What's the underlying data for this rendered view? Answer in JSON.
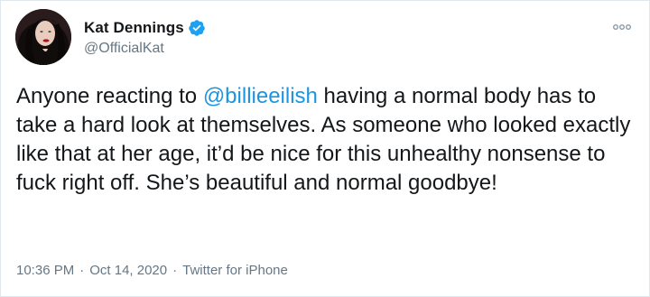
{
  "author": {
    "name": "Kat Dennings",
    "handle": "@OfficialKat",
    "verified": true
  },
  "tweet": {
    "text_before": "Anyone reacting to ",
    "mention": "@billieeilish",
    "text_after": " having a normal body has to take a hard look at themselves. As someone who looked exactly like that at her age, it’d be nice for this unhealthy nonsense to fuck right off. She’s beautiful and normal goodbye!"
  },
  "meta": {
    "time": "10:36 PM",
    "separator": "·",
    "date": "Oct 14, 2020",
    "source": "Twitter for iPhone"
  },
  "icons": {
    "verified": "verified-badge-icon",
    "more": "more-options-icon"
  },
  "colors": {
    "link": "#1b95e0",
    "verified": "#1da1f2",
    "text": "#14171a",
    "secondary": "#657786",
    "border": "#e1e8ed"
  }
}
